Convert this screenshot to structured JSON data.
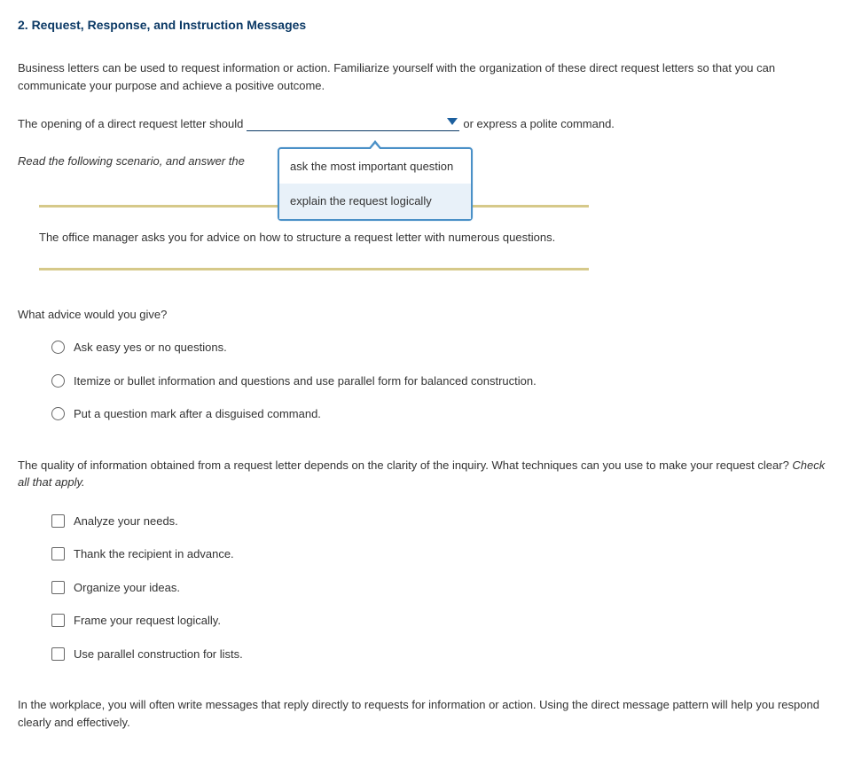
{
  "title": "2. Request, Response, and Instruction Messages",
  "intro": "Business letters can be used to request information or action. Familiarize yourself with the organization of these direct request letters so that you can communicate your purpose and achieve a positive outcome.",
  "fill": {
    "before": "The opening of a direct request letter should ",
    "after": " or express a polite command."
  },
  "dropdown": {
    "options": [
      "ask the most important question",
      "explain the request logically"
    ]
  },
  "scenario_lead": "Read the following scenario, and answer the ",
  "scenario": "The office manager asks you for advice on how to structure a request letter with numerous questions.",
  "q1": {
    "prompt": "What advice would you give?",
    "options": [
      "Ask easy yes or no questions.",
      "Itemize or bullet information and questions and use parallel form for balanced construction.",
      "Put a question mark after a disguised command."
    ]
  },
  "q2": {
    "prompt_main": "The quality of information obtained from a request letter depends on the clarity of the inquiry. What techniques can you use to make your request clear? ",
    "prompt_italic": "Check all that apply.",
    "options": [
      "Analyze your needs.",
      "Thank the recipient in advance.",
      "Organize your ideas.",
      "Frame your request logically.",
      "Use parallel construction for lists."
    ]
  },
  "closing": "In the workplace, you will often write messages that reply directly to requests for information or action. Using the direct message pattern will help you respond clearly and effectively."
}
